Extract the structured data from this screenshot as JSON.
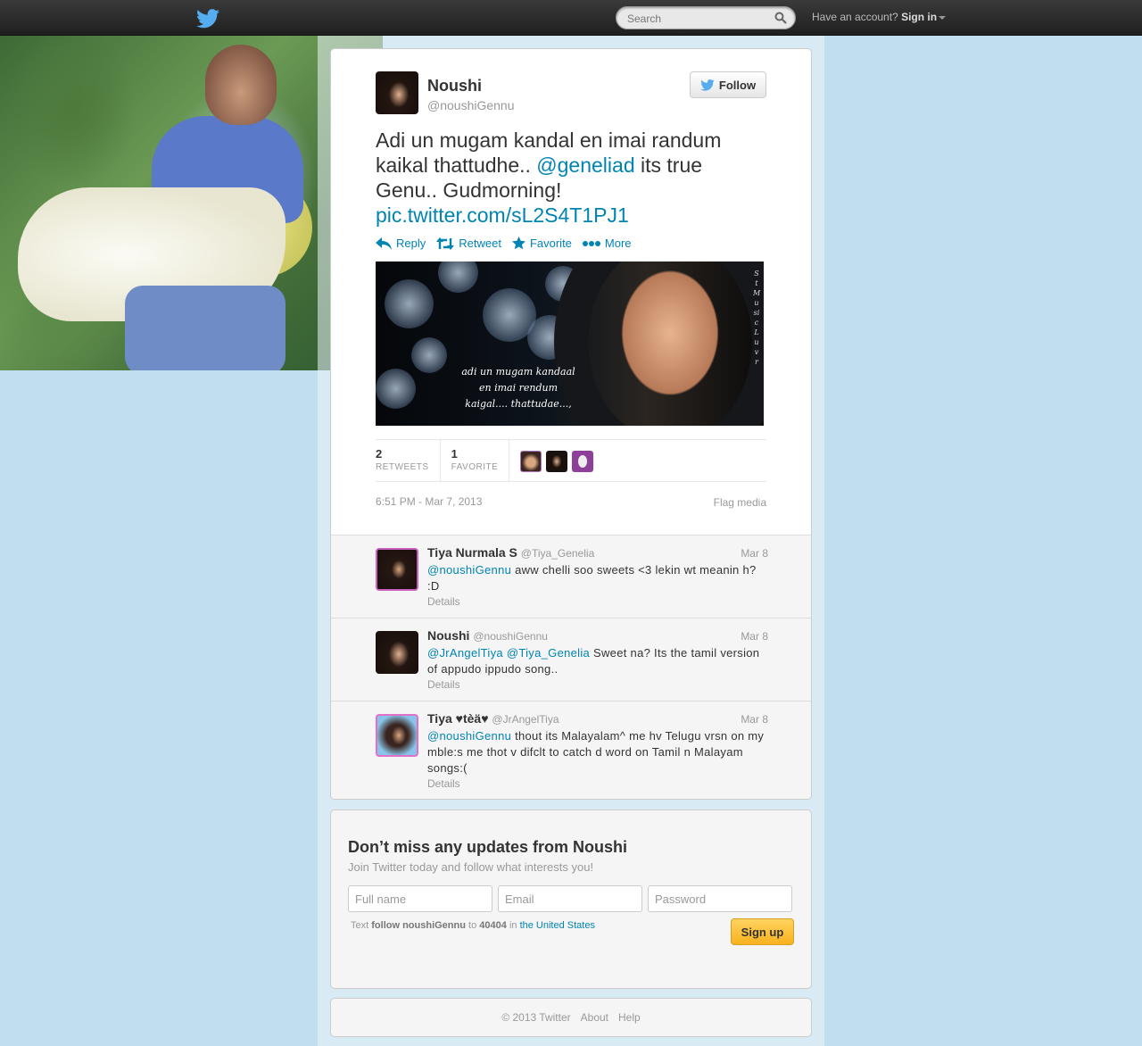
{
  "topbar": {
    "search_placeholder": "Search",
    "signin_prefix": "Have an account?",
    "signin_label": "Sign in"
  },
  "tweet": {
    "name": "Noushi",
    "handle": "@noushiGennu",
    "follow_label": "Follow",
    "text_part1": "Adi un mugam kandal en imai randum kaikal thattudhe..",
    "mention": "@geneliad",
    "text_part2": "its true Genu.. Gudmorning!",
    "pic_link": "pic.twitter.com/sL2S4T1PJ1",
    "actions": {
      "reply": "Reply",
      "retweet": "Retweet",
      "favorite": "Favorite",
      "more": "More"
    },
    "media": {
      "caption_line1": "adi un mugam kandaal",
      "caption_line2": "en imai rendum",
      "caption_line3": "kaigal.... thattudae...,",
      "side_text": "StMusicLuvr"
    },
    "stats": {
      "retweets_count": "2",
      "retweets_label": "RETWEETS",
      "favorites_count": "1",
      "favorites_label": "FAVORITE"
    },
    "timestamp": "6:51 PM - Mar 7, 2013",
    "flag_label": "Flag media"
  },
  "replies": [
    {
      "name": "Tiya Nurmala S",
      "handle": "@Tiya_Genelia",
      "date": "Mar 8",
      "mention": "@noushiGennu",
      "text": "aww chelli soo sweets <3 lekin wt meanin h? :D",
      "details": "Details"
    },
    {
      "name": "Noushi",
      "handle": "@noushiGennu",
      "date": "Mar 8",
      "mention": "@JrAngelTiya @Tiya_Genelia",
      "text": "Sweet na? Its the tamil version of appudo ippudo song..",
      "details": "Details"
    },
    {
      "name": "Tiya ♥tèä♥",
      "handle": "@JrAngelTiya",
      "date": "Mar 8",
      "mention": "@noushiGennu",
      "text": "thout its Malayalam^ me hv Telugu vrsn on my mble:s me thot v difclt to catch d word on Tamil n Malayam songs:(",
      "details": "Details"
    }
  ],
  "signup": {
    "title": "Don’t miss any updates from Noushi",
    "subtitle": "Join Twitter today and follow what interests you!",
    "fullname_placeholder": "Full name",
    "email_placeholder": "Email",
    "password_placeholder": "Password",
    "sms_prefix": "Text",
    "sms_command": "follow noushiGennu",
    "sms_to": "to",
    "sms_number": "40404",
    "sms_in": "in",
    "sms_country": "the United States",
    "button_label": "Sign up"
  },
  "footer": {
    "copyright": "© 2013 Twitter",
    "about": "About",
    "help": "Help"
  },
  "colors": {
    "link": "#0084b4",
    "background": "#c0deed",
    "twitter_blue": "#55acee"
  }
}
